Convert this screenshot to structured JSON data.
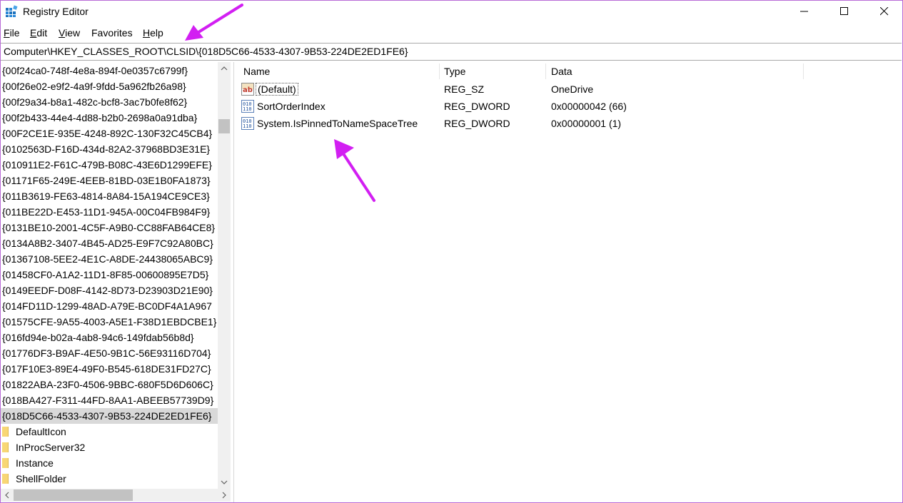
{
  "window": {
    "title": "Registry Editor"
  },
  "menu": [
    {
      "label": "File",
      "u": "F",
      "rest": "ile"
    },
    {
      "label": "Edit",
      "u": "E",
      "rest": "dit"
    },
    {
      "label": "View",
      "u": "V",
      "rest": "iew"
    },
    {
      "label": "Favorites",
      "u": "",
      "rest": "Favorites"
    },
    {
      "label": "Help",
      "u": "H",
      "rest": "elp"
    }
  ],
  "address": {
    "path": "Computer\\HKEY_CLASSES_ROOT\\CLSID\\{018D5C66-4533-4307-9B53-224DE2ED1FE6}"
  },
  "tree": {
    "keys": [
      "{00f24ca0-748f-4e8a-894f-0e0357c6799f}",
      "{00f26e02-e9f2-4a9f-9fdd-5a962fb26a98}",
      "{00f29a34-b8a1-482c-bcf8-3ac7b0fe8f62}",
      "{00f2b433-44e4-4d88-b2b0-2698a0a91dba}",
      "{00F2CE1E-935E-4248-892C-130F32C45CB4}",
      "{0102563D-F16D-434d-82A2-37968BD3E31E}",
      "{010911E2-F61C-479B-B08C-43E6D1299EFE}",
      "{01171F65-249E-4EEB-81BD-03E1B0FA1873}",
      "{011B3619-FE63-4814-8A84-15A194CE9CE3}",
      "{011BE22D-E453-11D1-945A-00C04FB984F9}",
      "{0131BE10-2001-4C5F-A9B0-CC88FAB64CE8}",
      "{0134A8B2-3407-4B45-AD25-E9F7C92A80BC}",
      "{01367108-5EE2-4E1C-A8DE-24438065ABC9}",
      "{01458CF0-A1A2-11D1-8F85-00600895E7D5}",
      "{0149EEDF-D08F-4142-8D73-D23903D21E90}",
      "{014FD11D-1299-48AD-A79E-BC0DF4A1A967",
      "{01575CFE-9A55-4003-A5E1-F38D1EBDCBE1}",
      "{016fd94e-b02a-4ab8-94c6-149fdab56b8d}",
      "{01776DF3-B9AF-4E50-9B1C-56E93116D704}",
      "{017F10E3-89E4-49F0-B545-618DE31FD27C}",
      "{01822ABA-23F0-4506-9BBC-680F5D6D606C}",
      "{018BA427-F311-44FD-8AA1-ABEEB57739D9}",
      "{018D5C66-4533-4307-9B53-224DE2ED1FE6}"
    ],
    "selected_index": 22,
    "children": [
      "DefaultIcon",
      "InProcServer32",
      "Instance",
      "ShellFolder"
    ]
  },
  "list": {
    "columns": {
      "name": "Name",
      "type": "Type",
      "data": "Data"
    },
    "rows": [
      {
        "name": "(Default)",
        "type": "REG_SZ",
        "data": "OneDrive",
        "icon": "string-value-icon"
      },
      {
        "name": "SortOrderIndex",
        "type": "REG_DWORD",
        "data": "0x00000042 (66)",
        "icon": "binary-value-icon"
      },
      {
        "name": "System.IsPinnedToNameSpaceTree",
        "type": "REG_DWORD",
        "data": "0x00000001 (1)",
        "icon": "binary-value-icon"
      }
    ]
  },
  "colors": {
    "annotation_arrow": "#d21ff2",
    "selection": "#d9d9d9",
    "folder": "#f8d775"
  }
}
